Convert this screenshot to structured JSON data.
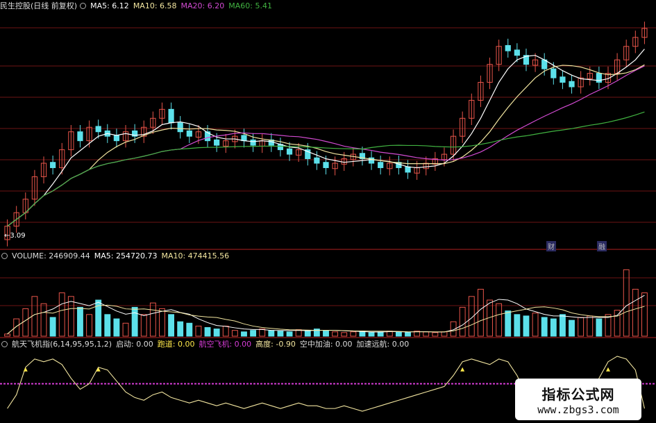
{
  "colors": {
    "up": "#e8554a",
    "down": "#5ce0ea",
    "ma5": "#ffffff",
    "ma10": "#f3e6a0",
    "ma20": "#d24bd2",
    "ma60": "#41b341",
    "grid": "#6e1414",
    "magenta": "#d63cd6",
    "yellow": "#ffe94a"
  },
  "price_header": {
    "title": "民生控股(日线 前复权)",
    "ma5": "MA5: 6.12",
    "ma10": "MA10: 6.58",
    "ma20": "MA20: 6.20",
    "ma60": "MA60: 5.41"
  },
  "volume_header": {
    "volume": "VOLUME: 246909.44",
    "ma5": "MA5: 254720.73",
    "ma10": "MA10: 474415.56"
  },
  "indicator_header": {
    "name": "航天飞机指(6,14,95,95,1,2)",
    "start": "启动: 0.00",
    "runway": "跑道: 0.00",
    "aircraft": "航空飞机: 0.00",
    "height": "高度: -0.90",
    "refuel": "空中加油: 0.00",
    "accel": "加速远航: 0.00"
  },
  "annotations": {
    "low_price": "3.09",
    "tag1": "财",
    "tag2": "融"
  },
  "watermark": {
    "title": "指标公式网",
    "url": "www.zbgs3.com"
  },
  "chart_data": [
    {
      "type": "candlestick",
      "title": "民生控股(日线 前复权)",
      "series": [
        {
          "name": "MA5",
          "value_label": "6.12"
        },
        {
          "name": "MA10",
          "value_label": "6.58"
        },
        {
          "name": "MA20",
          "value_label": "6.20"
        },
        {
          "name": "MA60",
          "value_label": "5.41"
        }
      ],
      "low_annotation": 3.09,
      "closes": [
        3.2,
        3.5,
        3.8,
        4.3,
        4.6,
        4.5,
        4.9,
        5.3,
        5.1,
        5.4,
        5.3,
        5.2,
        5.1,
        5.3,
        5.2,
        5.4,
        5.6,
        5.8,
        5.5,
        5.3,
        5.2,
        5.3,
        5.1,
        5.0,
        5.1,
        5.2,
        5.1,
        5.0,
        5.1,
        5.0,
        4.9,
        4.8,
        4.9,
        4.7,
        4.6,
        4.5,
        4.6,
        4.7,
        4.8,
        4.7,
        4.6,
        4.5,
        4.6,
        4.5,
        4.4,
        4.5,
        4.6,
        4.7,
        4.8,
        5.2,
        5.6,
        6.0,
        6.4,
        6.8,
        7.2,
        7.1,
        7.0,
        6.8,
        6.9,
        6.7,
        6.5,
        6.4,
        6.3,
        6.5,
        6.6,
        6.4,
        6.6,
        6.9,
        7.2,
        7.4,
        7.6
      ],
      "up_flags": [
        1,
        1,
        1,
        1,
        1,
        0,
        1,
        1,
        0,
        1,
        0,
        0,
        0,
        1,
        0,
        1,
        1,
        1,
        0,
        0,
        0,
        1,
        0,
        0,
        1,
        1,
        0,
        0,
        1,
        0,
        0,
        0,
        1,
        0,
        0,
        0,
        1,
        1,
        1,
        0,
        0,
        0,
        1,
        0,
        0,
        1,
        1,
        1,
        1,
        1,
        1,
        1,
        1,
        1,
        1,
        0,
        0,
        0,
        1,
        0,
        0,
        0,
        0,
        1,
        1,
        0,
        1,
        1,
        1,
        1,
        1
      ]
    },
    {
      "type": "bar",
      "title": "VOLUME",
      "series": [
        {
          "name": "VOLUME",
          "value_label": "246909.44"
        },
        {
          "name": "MA5",
          "value_label": "254720.73"
        },
        {
          "name": "MA10",
          "value_label": "474415.56"
        }
      ],
      "values": [
        3,
        24,
        38,
        55,
        45,
        26,
        60,
        55,
        40,
        30,
        50,
        30,
        24,
        18,
        40,
        30,
        46,
        38,
        30,
        20,
        18,
        14,
        12,
        10,
        14,
        8,
        6,
        8,
        10,
        8,
        7,
        6,
        9,
        8,
        10,
        8,
        6,
        5,
        6,
        7,
        5,
        6,
        7,
        6,
        5,
        7,
        6,
        5,
        6,
        20,
        40,
        55,
        65,
        50,
        45,
        35,
        30,
        28,
        32,
        26,
        24,
        30,
        22,
        26,
        28,
        24,
        30,
        36,
        92,
        65,
        60
      ],
      "up_flags": [
        1,
        1,
        1,
        1,
        1,
        0,
        1,
        1,
        0,
        1,
        0,
        0,
        0,
        1,
        0,
        1,
        1,
        1,
        0,
        0,
        0,
        1,
        0,
        0,
        1,
        1,
        0,
        0,
        1,
        0,
        0,
        0,
        1,
        0,
        0,
        0,
        1,
        1,
        1,
        0,
        0,
        0,
        1,
        0,
        0,
        1,
        1,
        1,
        1,
        1,
        1,
        1,
        1,
        1,
        1,
        0,
        0,
        0,
        1,
        0,
        0,
        0,
        0,
        1,
        1,
        0,
        1,
        1,
        1,
        1,
        1
      ]
    },
    {
      "type": "line",
      "title": "航天飞机指(6,14,95,95,1,2)",
      "series": [
        {
          "name": "启动",
          "value_label": "0.00"
        },
        {
          "name": "跑道",
          "value_label": "0.00"
        },
        {
          "name": "航空飞机",
          "value_label": "0.00"
        },
        {
          "name": "高度",
          "value_label": "-0.90"
        },
        {
          "name": "空中加油",
          "value_label": "0.00"
        },
        {
          "name": "加速远航",
          "value_label": "0.00"
        }
      ],
      "height_values": [
        -0.9,
        -0.4,
        0.6,
        0.9,
        0.8,
        0.9,
        0.7,
        0.2,
        -0.2,
        0.0,
        0.6,
        0.5,
        0.1,
        -0.3,
        -0.5,
        -0.6,
        -0.4,
        -0.3,
        -0.5,
        -0.6,
        -0.7,
        -0.6,
        -0.7,
        -0.8,
        -0.7,
        -0.8,
        -0.9,
        -0.8,
        -0.7,
        -0.8,
        -0.9,
        -0.8,
        -0.7,
        -0.8,
        -0.8,
        -0.9,
        -0.9,
        -0.8,
        -0.9,
        -1.0,
        -0.9,
        -0.8,
        -0.7,
        -0.6,
        -0.5,
        -0.4,
        -0.3,
        -0.2,
        -0.1,
        0.3,
        0.8,
        0.9,
        0.8,
        0.7,
        0.9,
        0.8,
        0.3,
        -0.4,
        -0.7,
        -0.9,
        -1.0,
        -0.9,
        -0.8,
        -0.9,
        -0.6,
        0.2,
        0.8,
        1.0,
        0.9,
        0.5,
        -0.9
      ],
      "ylim": [
        -1.2,
        1.2
      ]
    }
  ]
}
